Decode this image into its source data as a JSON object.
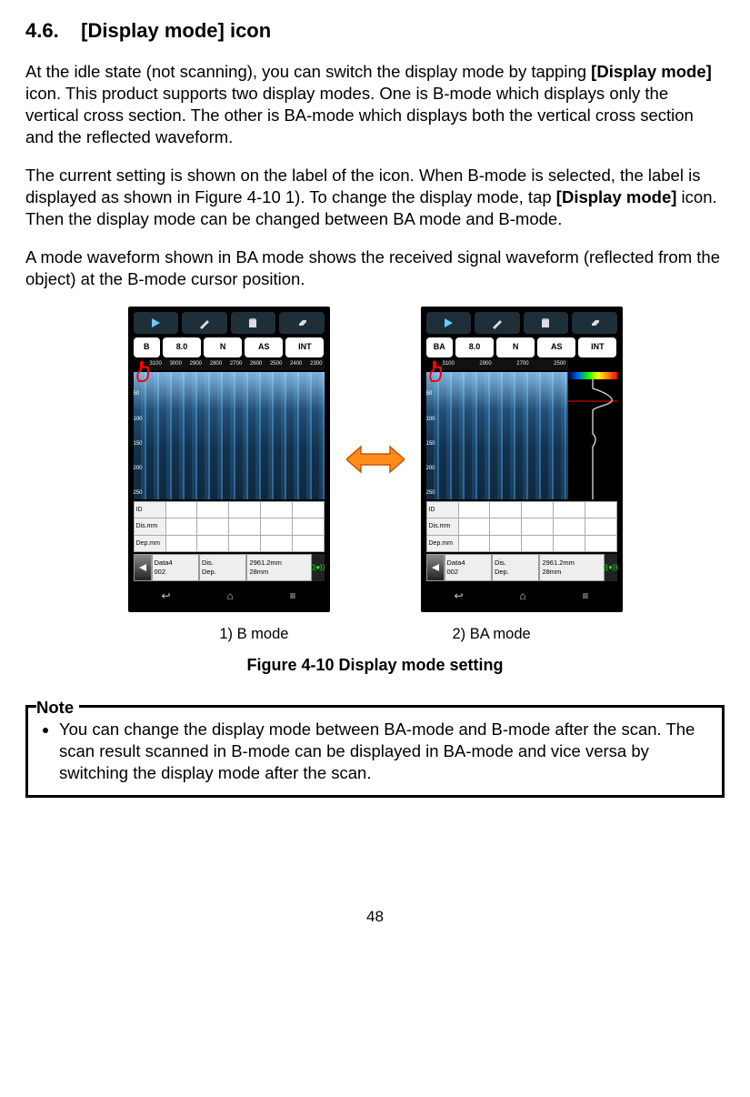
{
  "section": {
    "number": "4.6.",
    "title": "[Display mode] icon"
  },
  "paragraph1": {
    "pre": "At the idle state (not scanning), you can switch the display mode by tapping ",
    "bold1": "[Display mode]",
    "post": " icon. This product supports two display modes. One is B-mode which displays only the vertical cross section. The other is BA-mode which displays both the vertical cross section and the reflected waveform."
  },
  "paragraph2": {
    "pre": "The current setting is shown on the label of the icon. When B-mode is selected, the label is displayed as shown in Figure 4-10 1). To change the display mode, tap ",
    "bold1": "[Display mode]",
    "post": " icon. Then the display mode can be changed between BA mode and B-mode."
  },
  "paragraph3": "A mode waveform shown in BA mode shows the received signal waveform (reflected from the object) at the B-mode cursor position.",
  "device_common": {
    "pills": {
      "p2": "8.0",
      "p3": "N",
      "p4": "AS",
      "p5": "INT"
    },
    "ruler": [
      "3100",
      "3000",
      "2900",
      "2800",
      "2700",
      "2600",
      "2500",
      "2400",
      "2300"
    ],
    "yticks": [
      "",
      "50",
      "100",
      "150",
      "200",
      "250"
    ],
    "grid_labels": {
      "r1": "ID",
      "r2": "Dis.mm",
      "r3": "Dep.mm"
    },
    "status": {
      "c1a": "Data4",
      "c1b": "002",
      "c2a": "Dis.",
      "c2b": "Dep.",
      "c3a": "2961.2mm",
      "c3b": "28mm"
    }
  },
  "device_left": {
    "mode_pill": "B"
  },
  "device_right": {
    "mode_pill": "BA"
  },
  "captions": {
    "left": "1) B mode",
    "right": "2) BA mode"
  },
  "figure_caption": "Figure 4-10 Display mode setting",
  "note": {
    "label": "Note",
    "bullet": "You can change the display mode between BA-mode and B-mode after the scan. The scan result scanned in B-mode can be displayed in BA-mode and vice versa by switching the display mode after the scan."
  },
  "page_number": "48"
}
